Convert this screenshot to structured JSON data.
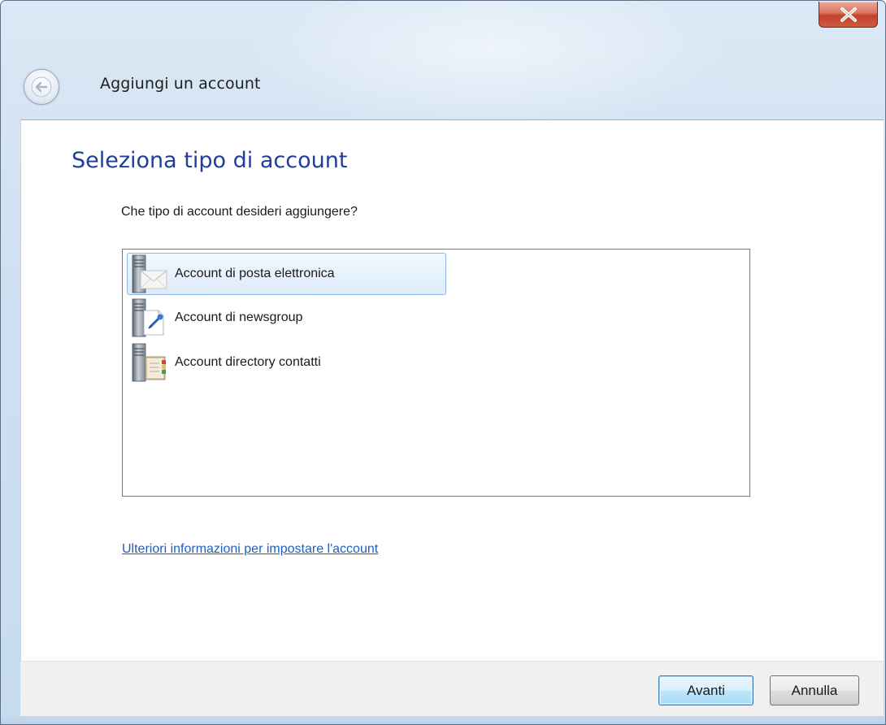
{
  "window": {
    "title": "Aggiungi un account",
    "close_icon": "close-icon",
    "back_icon": "back-arrow-icon"
  },
  "page": {
    "heading": "Seleziona tipo di account",
    "question": "Che tipo di account desideri aggiungere?"
  },
  "account_types": {
    "selected_index": 0,
    "items": [
      {
        "label": "Account di posta elettronica",
        "icon": "email-server-icon"
      },
      {
        "label": "Account di newsgroup",
        "icon": "newsgroup-server-icon"
      },
      {
        "label": "Account directory contatti",
        "icon": "directory-server-icon"
      }
    ]
  },
  "help_link": {
    "text": "Ulteriori informazioni per impostare l'account"
  },
  "footer": {
    "next_label": "Avanti",
    "cancel_label": "Annulla"
  },
  "colors": {
    "heading": "#1e3f9c",
    "link": "#1a5fc4",
    "selection_border": "#8fb6dc",
    "close_button": "#c2412a"
  }
}
